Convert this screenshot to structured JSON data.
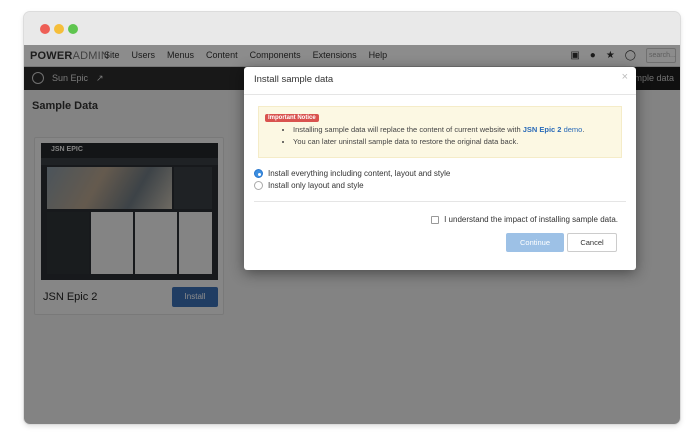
{
  "app": {
    "logo_bold": "POWER",
    "logo_rest": "ADMIN"
  },
  "menu": {
    "items": [
      "Site",
      "Users",
      "Menus",
      "Content",
      "Components",
      "Extensions",
      "Help"
    ]
  },
  "tools": {
    "icons": [
      "monitor-icon",
      "user-icon",
      "star-icon",
      "help-icon"
    ],
    "search_placeholder": "search..."
  },
  "toolbar": {
    "site_name": "Sun Epic",
    "right_button": "mple data"
  },
  "page": {
    "title": "Sample Data"
  },
  "card": {
    "title": "JSN Epic 2",
    "install_label": "Install",
    "thumb_brand": "JSN EPIC"
  },
  "modal": {
    "title": "Install sample data",
    "close": "×",
    "notice_tag": "Important Notice",
    "notice_line1_pre": "Installing sample data will replace the content of current website with ",
    "notice_line1_link": "JSN Epic 2",
    "notice_line1_link2": " demo",
    "notice_line1_post": ".",
    "notice_line2": "You can later uninstall sample data to restore the original data back.",
    "option1": "Install everything including content, layout and style",
    "option2": "Install only layout and style",
    "agree_label": "I understand the impact of installing sample data.",
    "continue_label": "Continue",
    "cancel_label": "Cancel"
  },
  "colors": {
    "accent": "#3b6fb4",
    "notice_tag": "#d9534f",
    "notice_bg": "#fcf8e3",
    "continue_disabled": "#9dc1e6"
  }
}
